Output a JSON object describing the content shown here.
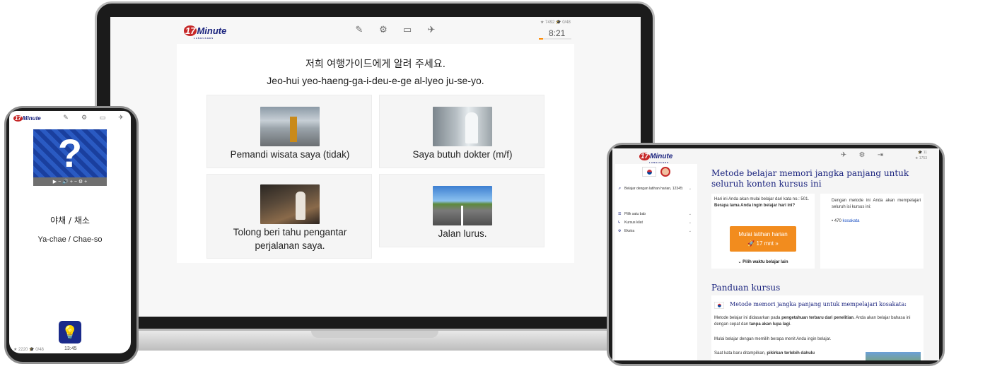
{
  "brand": {
    "logo_number": "17",
    "logo_word": "Minute",
    "logo_sub": "LANGUAGES"
  },
  "laptop": {
    "toolbar_icons": [
      "quiz-mode-icon",
      "gear-icon",
      "vocabulary-card-icon",
      "hide-translation-icon"
    ],
    "stats": "★ 7492  🎓 0/48",
    "timer": "8:21",
    "progress": 0.12,
    "question_native": "저희 여행가이드에게 알려 주세요.",
    "question_romanized": "Jeo-hui yeo-haeng-ga-i-deu-e-ge al-lyeo ju-se-yo.",
    "options": [
      {
        "label": "Pemandi wisata saya (tidak)",
        "image": "airport-guide"
      },
      {
        "label": "Saya butuh dokter (m/f)",
        "image": "doctor"
      },
      {
        "label": "Tolong beri tahu pengantar perjalanan saya.",
        "image": "hotel-reception"
      },
      {
        "label": "Jalan lurus.",
        "image": "straight-road"
      }
    ]
  },
  "phone": {
    "toolbar_icons": [
      "quiz-mode-icon",
      "gear-icon",
      "vocabulary-card-icon",
      "hide-translation-icon"
    ],
    "quiz_mark": "?",
    "player_controls": "▶  −  🔊  +   −  ⚙  +",
    "word_native": "야채 / 채소",
    "word_romanized": "Ya-chae / Chae-so",
    "stats": "★ 2220  🎓 0/48",
    "timer": "13:45"
  },
  "tablet": {
    "toolbar_icons": [
      "hide-translation-icon",
      "gear-icon",
      "logout-icon"
    ],
    "stats_top": "🎓 11",
    "stats_bottom": "★ 1753",
    "sidebar": [
      {
        "icon": "rocket-icon",
        "label": "Belajar dengan latihan harian, 12345:"
      },
      {
        "icon": "list-icon",
        "label": "Pilih satu bab"
      },
      {
        "icon": "lightning-icon",
        "label": "Kursus kilat"
      },
      {
        "icon": "gear-icon",
        "label": "Ekstra"
      }
    ],
    "heading": "Metode belajar memori jangka panjang untuk seluruh konten kursus ini",
    "daily_intro": "Hari ini Anda akan mulai belajar dari kata no.: 501.",
    "daily_question": "Berapa lama Anda ingin belajar hari ini?",
    "cta_line1": "Mulai latihan harian",
    "cta_line2": "🚀 17 mnt »",
    "other_time": "⌄ Pilih waktu belajar lain",
    "method_text": "Dengan metode ini Anda akan mempelajari seluruh isi kursus ini:",
    "word_count_prefix": "• 470 ",
    "word_count_link": "kosakata",
    "guide_heading": "Panduan kursus",
    "guide_title": "Metode memori jangka panjang untuk mempelajari kosakata:",
    "guide_p1_a": "Metode belajar ini didasarkan pada ",
    "guide_p1_b": "pengetahuan terbaru dari penelitian",
    "guide_p1_c": ". Anda akan belajar bahasa ini dengan cepat dan ",
    "guide_p1_d": "tanpa akan lupa lagi",
    "guide_p1_e": ".",
    "guide_p2": "Mulai belajar dengan memilih berapa menit Anda ingin belajar.",
    "guide_p3_a": "Saat kata baru ditampilkan, ",
    "guide_p3_b": "pikirkan terlebih dahulu"
  }
}
